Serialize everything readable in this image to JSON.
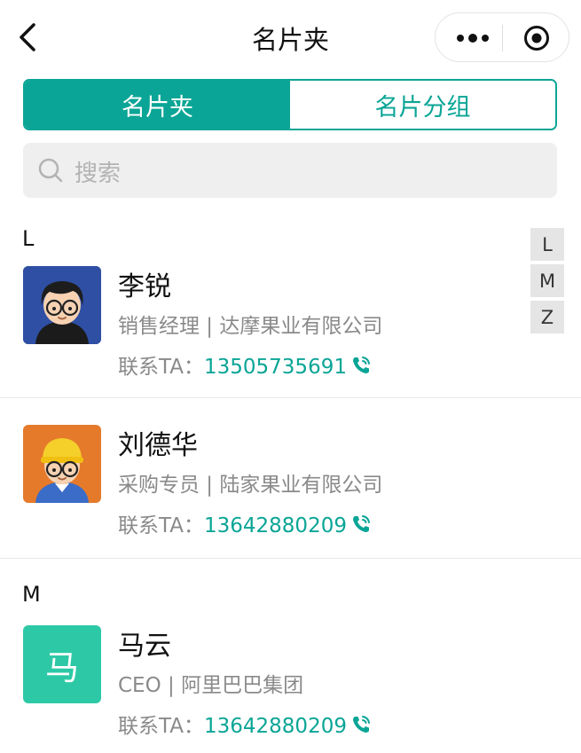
{
  "navbar": {
    "title": "名片夹"
  },
  "tabs": [
    {
      "label": "名片夹"
    },
    {
      "label": "名片分组"
    }
  ],
  "search": {
    "placeholder": "搜索"
  },
  "index_letters": [
    "L",
    "M",
    "Z"
  ],
  "sections": [
    {
      "letter": "L"
    },
    {
      "letter": "M"
    }
  ],
  "contacts": [
    {
      "name": "李锐",
      "title_line": "销售经理 | 达摩果业有限公司",
      "contact_label": "联系TA：",
      "phone": "13505735691",
      "avatar": "cartoon-man-black-hair"
    },
    {
      "name": "刘德华",
      "title_line": "采购专员 | 陆家果业有限公司",
      "contact_label": "联系TA：",
      "phone": "13642880209",
      "avatar": "cartoon-man-yellow-hat"
    },
    {
      "name": "马云",
      "title_line": "CEO | 阿里巴巴集团",
      "contact_label": "联系TA：",
      "phone": "13642880209",
      "avatar_text": "马"
    }
  ],
  "colors": {
    "accent": "#0aa596",
    "text_avatar": "#2dc9a6"
  }
}
